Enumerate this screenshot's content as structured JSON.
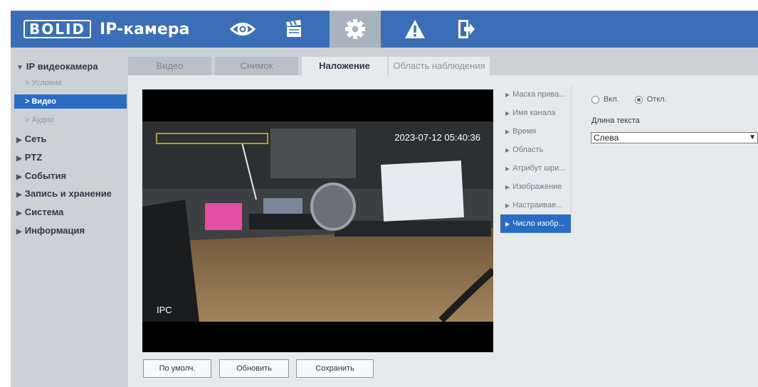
{
  "header": {
    "logo": "BOLID",
    "title": "IP-камера",
    "nav": [
      {
        "icon": "eye-icon"
      },
      {
        "icon": "clapperboard-icon"
      },
      {
        "icon": "gear-icon",
        "active": true
      },
      {
        "icon": "warning-icon"
      },
      {
        "icon": "logout-icon"
      }
    ]
  },
  "sidebar": {
    "groups": [
      {
        "label": "IP видеокамера",
        "expanded": true
      },
      {
        "label": "Сеть"
      },
      {
        "label": "PTZ"
      },
      {
        "label": "События"
      },
      {
        "label": "Запись и хранение"
      },
      {
        "label": "Система"
      },
      {
        "label": "Информация"
      }
    ],
    "sub_items": [
      {
        "label": "Условия"
      },
      {
        "label": "Видео",
        "active": true
      },
      {
        "label": "Аудио"
      }
    ]
  },
  "tabs": [
    {
      "label": "Видео"
    },
    {
      "label": "Снимок"
    },
    {
      "label": "Наложение",
      "active": true
    },
    {
      "label": "Область наблюдения"
    }
  ],
  "video": {
    "timestamp": "2023-07-12 05:40:36",
    "channel_name": "IPC"
  },
  "overlay_list": [
    {
      "label": "Маска прива..."
    },
    {
      "label": "Имя канала"
    },
    {
      "label": "Время"
    },
    {
      "label": "Область"
    },
    {
      "label": "Атрибут шри..."
    },
    {
      "label": "Изображение"
    },
    {
      "label": "Настраивае..."
    },
    {
      "label": "Число изобр...",
      "active": true
    }
  ],
  "settings": {
    "on_label": "Вкл.",
    "off_label": "Откл.",
    "selected": "off",
    "text_length_label": "Длина текста",
    "text_length_value": "Слева"
  },
  "buttons": {
    "default": "По умолч.",
    "refresh": "Обновить",
    "save": "Сохранить"
  },
  "colors": {
    "header": "#3a6fb7",
    "accent": "#2a6cc4",
    "panel": "#e7eaed",
    "sidebar": "#ccd1d6"
  }
}
